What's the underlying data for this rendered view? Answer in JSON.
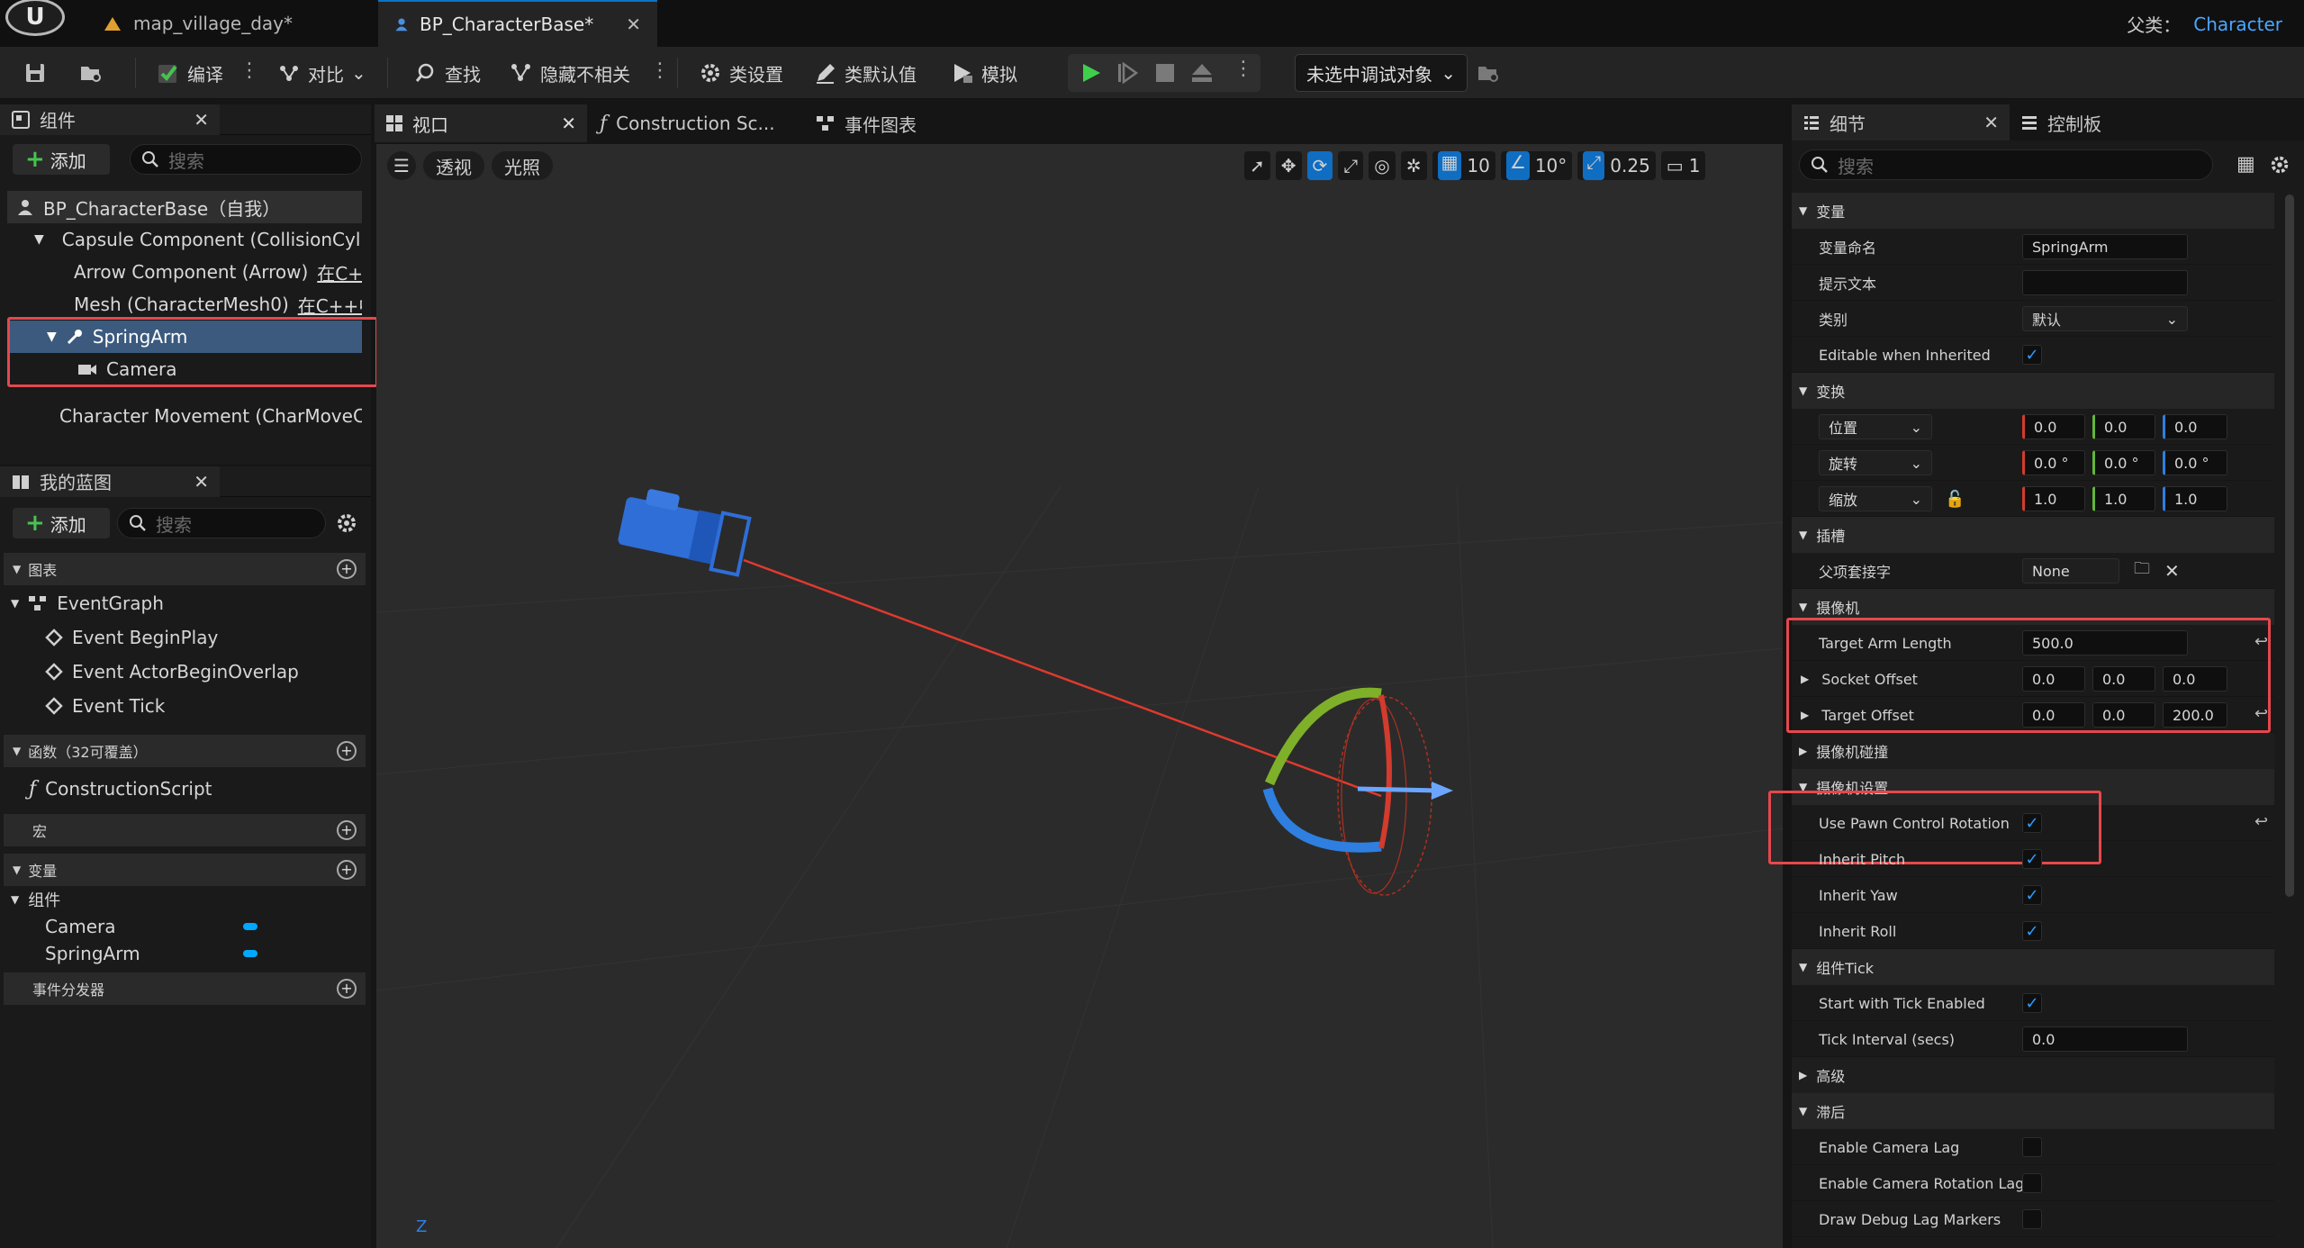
{
  "title_bar": {
    "tabs": [
      {
        "label": "map_village_day*",
        "icon": "level-icon"
      },
      {
        "label": "BP_CharacterBase*",
        "icon": "blueprint-icon"
      }
    ],
    "parent_class_label": "父类：",
    "parent_class_value": "Character"
  },
  "toolbar": {
    "compile": "编译",
    "diff": "对比",
    "find": "查找",
    "hide_unrelated": "隐藏不相关",
    "class_settings": "类设置",
    "class_defaults": "类默认值",
    "simulate": "模拟",
    "debug_object": "未选中调试对象"
  },
  "components_panel": {
    "title": "组件",
    "add": "添加",
    "search_placeholder": "搜索",
    "tree": [
      {
        "label": "BP_CharacterBase（自我）",
        "suffix": ""
      },
      {
        "label": "Capsule Component (CollisionCylinder)",
        "suffix": ""
      },
      {
        "label": "Arrow Component (Arrow)",
        "suffix": "在C++"
      },
      {
        "label": "Mesh (CharacterMesh0)",
        "suffix": "在C++中"
      },
      {
        "label": "SpringArm",
        "suffix": ""
      },
      {
        "label": "Camera",
        "suffix": ""
      },
      {
        "label": "Character Movement (CharMoveComp)",
        "suffix": ""
      }
    ]
  },
  "my_blueprint": {
    "title": "我的蓝图",
    "add": "添加",
    "search_placeholder": "搜索",
    "graphs_header": "图表",
    "event_graph": "EventGraph",
    "events": [
      "Event BeginPlay",
      "Event ActorBeginOverlap",
      "Event Tick"
    ],
    "functions_header": "函数（32可覆盖）",
    "construction_script": "ConstructionScript",
    "macros_header": "宏",
    "variables_header": "变量",
    "components_group": "组件",
    "variables": [
      "Camera",
      "SpringArm"
    ],
    "dispatchers_header": "事件分发器"
  },
  "editor_tabs": {
    "viewport": "视口",
    "construction": "Construction Sc...",
    "event_graph": "事件图表"
  },
  "viewport": {
    "perspective": "透视",
    "lit": "光照",
    "grid_snap": "10",
    "rotation_snap": "10°",
    "scale_snap": "0.25",
    "camera_speed": "1",
    "axis_label": "Z"
  },
  "details": {
    "tab_details": "细节",
    "tab_dashboard": "控制板",
    "search_placeholder": "搜索",
    "sections": {
      "variable": "变量",
      "transform": "变换",
      "sockets": "插槽",
      "camera": "摄像机",
      "camera_collision": "摄像机碰撞",
      "camera_settings": "摄像机设置",
      "component_tick": "组件Tick",
      "advanced": "高级",
      "lag": "滞后"
    },
    "variable_name_label": "变量命名",
    "variable_name_value": "SpringArm",
    "tooltip_label": "提示文本",
    "tooltip_value": "",
    "category_label": "类别",
    "category_value": "默认",
    "editable_inherited_label": "Editable when Inherited",
    "location_label": "位置",
    "location": [
      "0.0",
      "0.0",
      "0.0"
    ],
    "rotation_label": "旋转",
    "rotation": [
      "0.0 °",
      "0.0 °",
      "0.0 °"
    ],
    "scale_label": "缩放",
    "scale": [
      "1.0",
      "1.0",
      "1.0"
    ],
    "parent_socket_label": "父项套接字",
    "parent_socket_value": "None",
    "target_arm_length_label": "Target Arm Length",
    "target_arm_length": "500.0",
    "socket_offset_label": "Socket Offset",
    "socket_offset": [
      "0.0",
      "0.0",
      "0.0"
    ],
    "target_offset_label": "Target Offset",
    "target_offset": [
      "0.0",
      "0.0",
      "200.0"
    ],
    "use_pawn_control_rotation": "Use Pawn Control Rotation",
    "inherit_pitch": "Inherit Pitch",
    "inherit_yaw": "Inherit Yaw",
    "inherit_roll": "Inherit Roll",
    "start_tick": "Start with Tick Enabled",
    "tick_interval_label": "Tick Interval (secs)",
    "tick_interval": "0.0",
    "enable_camera_lag": "Enable Camera Lag",
    "enable_camera_rotation_lag": "Enable Camera Rotation Lag",
    "draw_debug_lag": "Draw Debug Lag Markers"
  },
  "colors": {
    "accent": "#0a74c8",
    "highlight_box": "#e5484d",
    "checkbox": "#2d9cff",
    "play_green": "#3fcf4d"
  }
}
